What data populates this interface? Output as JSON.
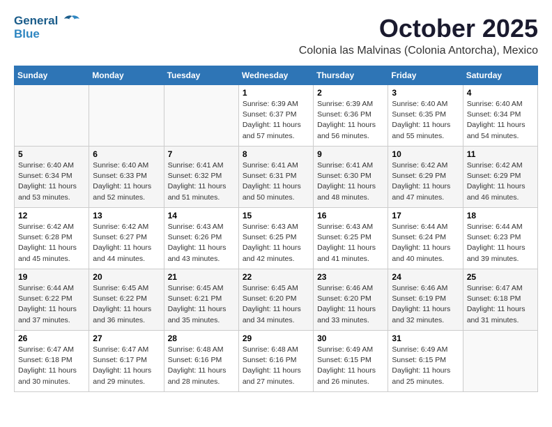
{
  "header": {
    "logo_line1": "General",
    "logo_line2": "Blue",
    "month": "October 2025",
    "location": "Colonia las Malvinas (Colonia Antorcha), Mexico"
  },
  "weekdays": [
    "Sunday",
    "Monday",
    "Tuesday",
    "Wednesday",
    "Thursday",
    "Friday",
    "Saturday"
  ],
  "weeks": [
    [
      {
        "day": "",
        "info": ""
      },
      {
        "day": "",
        "info": ""
      },
      {
        "day": "",
        "info": ""
      },
      {
        "day": "1",
        "info": "Sunrise: 6:39 AM\nSunset: 6:37 PM\nDaylight: 11 hours and 57 minutes."
      },
      {
        "day": "2",
        "info": "Sunrise: 6:39 AM\nSunset: 6:36 PM\nDaylight: 11 hours and 56 minutes."
      },
      {
        "day": "3",
        "info": "Sunrise: 6:40 AM\nSunset: 6:35 PM\nDaylight: 11 hours and 55 minutes."
      },
      {
        "day": "4",
        "info": "Sunrise: 6:40 AM\nSunset: 6:34 PM\nDaylight: 11 hours and 54 minutes."
      }
    ],
    [
      {
        "day": "5",
        "info": "Sunrise: 6:40 AM\nSunset: 6:34 PM\nDaylight: 11 hours and 53 minutes."
      },
      {
        "day": "6",
        "info": "Sunrise: 6:40 AM\nSunset: 6:33 PM\nDaylight: 11 hours and 52 minutes."
      },
      {
        "day": "7",
        "info": "Sunrise: 6:41 AM\nSunset: 6:32 PM\nDaylight: 11 hours and 51 minutes."
      },
      {
        "day": "8",
        "info": "Sunrise: 6:41 AM\nSunset: 6:31 PM\nDaylight: 11 hours and 50 minutes."
      },
      {
        "day": "9",
        "info": "Sunrise: 6:41 AM\nSunset: 6:30 PM\nDaylight: 11 hours and 48 minutes."
      },
      {
        "day": "10",
        "info": "Sunrise: 6:42 AM\nSunset: 6:29 PM\nDaylight: 11 hours and 47 minutes."
      },
      {
        "day": "11",
        "info": "Sunrise: 6:42 AM\nSunset: 6:29 PM\nDaylight: 11 hours and 46 minutes."
      }
    ],
    [
      {
        "day": "12",
        "info": "Sunrise: 6:42 AM\nSunset: 6:28 PM\nDaylight: 11 hours and 45 minutes."
      },
      {
        "day": "13",
        "info": "Sunrise: 6:42 AM\nSunset: 6:27 PM\nDaylight: 11 hours and 44 minutes."
      },
      {
        "day": "14",
        "info": "Sunrise: 6:43 AM\nSunset: 6:26 PM\nDaylight: 11 hours and 43 minutes."
      },
      {
        "day": "15",
        "info": "Sunrise: 6:43 AM\nSunset: 6:25 PM\nDaylight: 11 hours and 42 minutes."
      },
      {
        "day": "16",
        "info": "Sunrise: 6:43 AM\nSunset: 6:25 PM\nDaylight: 11 hours and 41 minutes."
      },
      {
        "day": "17",
        "info": "Sunrise: 6:44 AM\nSunset: 6:24 PM\nDaylight: 11 hours and 40 minutes."
      },
      {
        "day": "18",
        "info": "Sunrise: 6:44 AM\nSunset: 6:23 PM\nDaylight: 11 hours and 39 minutes."
      }
    ],
    [
      {
        "day": "19",
        "info": "Sunrise: 6:44 AM\nSunset: 6:22 PM\nDaylight: 11 hours and 37 minutes."
      },
      {
        "day": "20",
        "info": "Sunrise: 6:45 AM\nSunset: 6:22 PM\nDaylight: 11 hours and 36 minutes."
      },
      {
        "day": "21",
        "info": "Sunrise: 6:45 AM\nSunset: 6:21 PM\nDaylight: 11 hours and 35 minutes."
      },
      {
        "day": "22",
        "info": "Sunrise: 6:45 AM\nSunset: 6:20 PM\nDaylight: 11 hours and 34 minutes."
      },
      {
        "day": "23",
        "info": "Sunrise: 6:46 AM\nSunset: 6:20 PM\nDaylight: 11 hours and 33 minutes."
      },
      {
        "day": "24",
        "info": "Sunrise: 6:46 AM\nSunset: 6:19 PM\nDaylight: 11 hours and 32 minutes."
      },
      {
        "day": "25",
        "info": "Sunrise: 6:47 AM\nSunset: 6:18 PM\nDaylight: 11 hours and 31 minutes."
      }
    ],
    [
      {
        "day": "26",
        "info": "Sunrise: 6:47 AM\nSunset: 6:18 PM\nDaylight: 11 hours and 30 minutes."
      },
      {
        "day": "27",
        "info": "Sunrise: 6:47 AM\nSunset: 6:17 PM\nDaylight: 11 hours and 29 minutes."
      },
      {
        "day": "28",
        "info": "Sunrise: 6:48 AM\nSunset: 6:16 PM\nDaylight: 11 hours and 28 minutes."
      },
      {
        "day": "29",
        "info": "Sunrise: 6:48 AM\nSunset: 6:16 PM\nDaylight: 11 hours and 27 minutes."
      },
      {
        "day": "30",
        "info": "Sunrise: 6:49 AM\nSunset: 6:15 PM\nDaylight: 11 hours and 26 minutes."
      },
      {
        "day": "31",
        "info": "Sunrise: 6:49 AM\nSunset: 6:15 PM\nDaylight: 11 hours and 25 minutes."
      },
      {
        "day": "",
        "info": ""
      }
    ]
  ]
}
